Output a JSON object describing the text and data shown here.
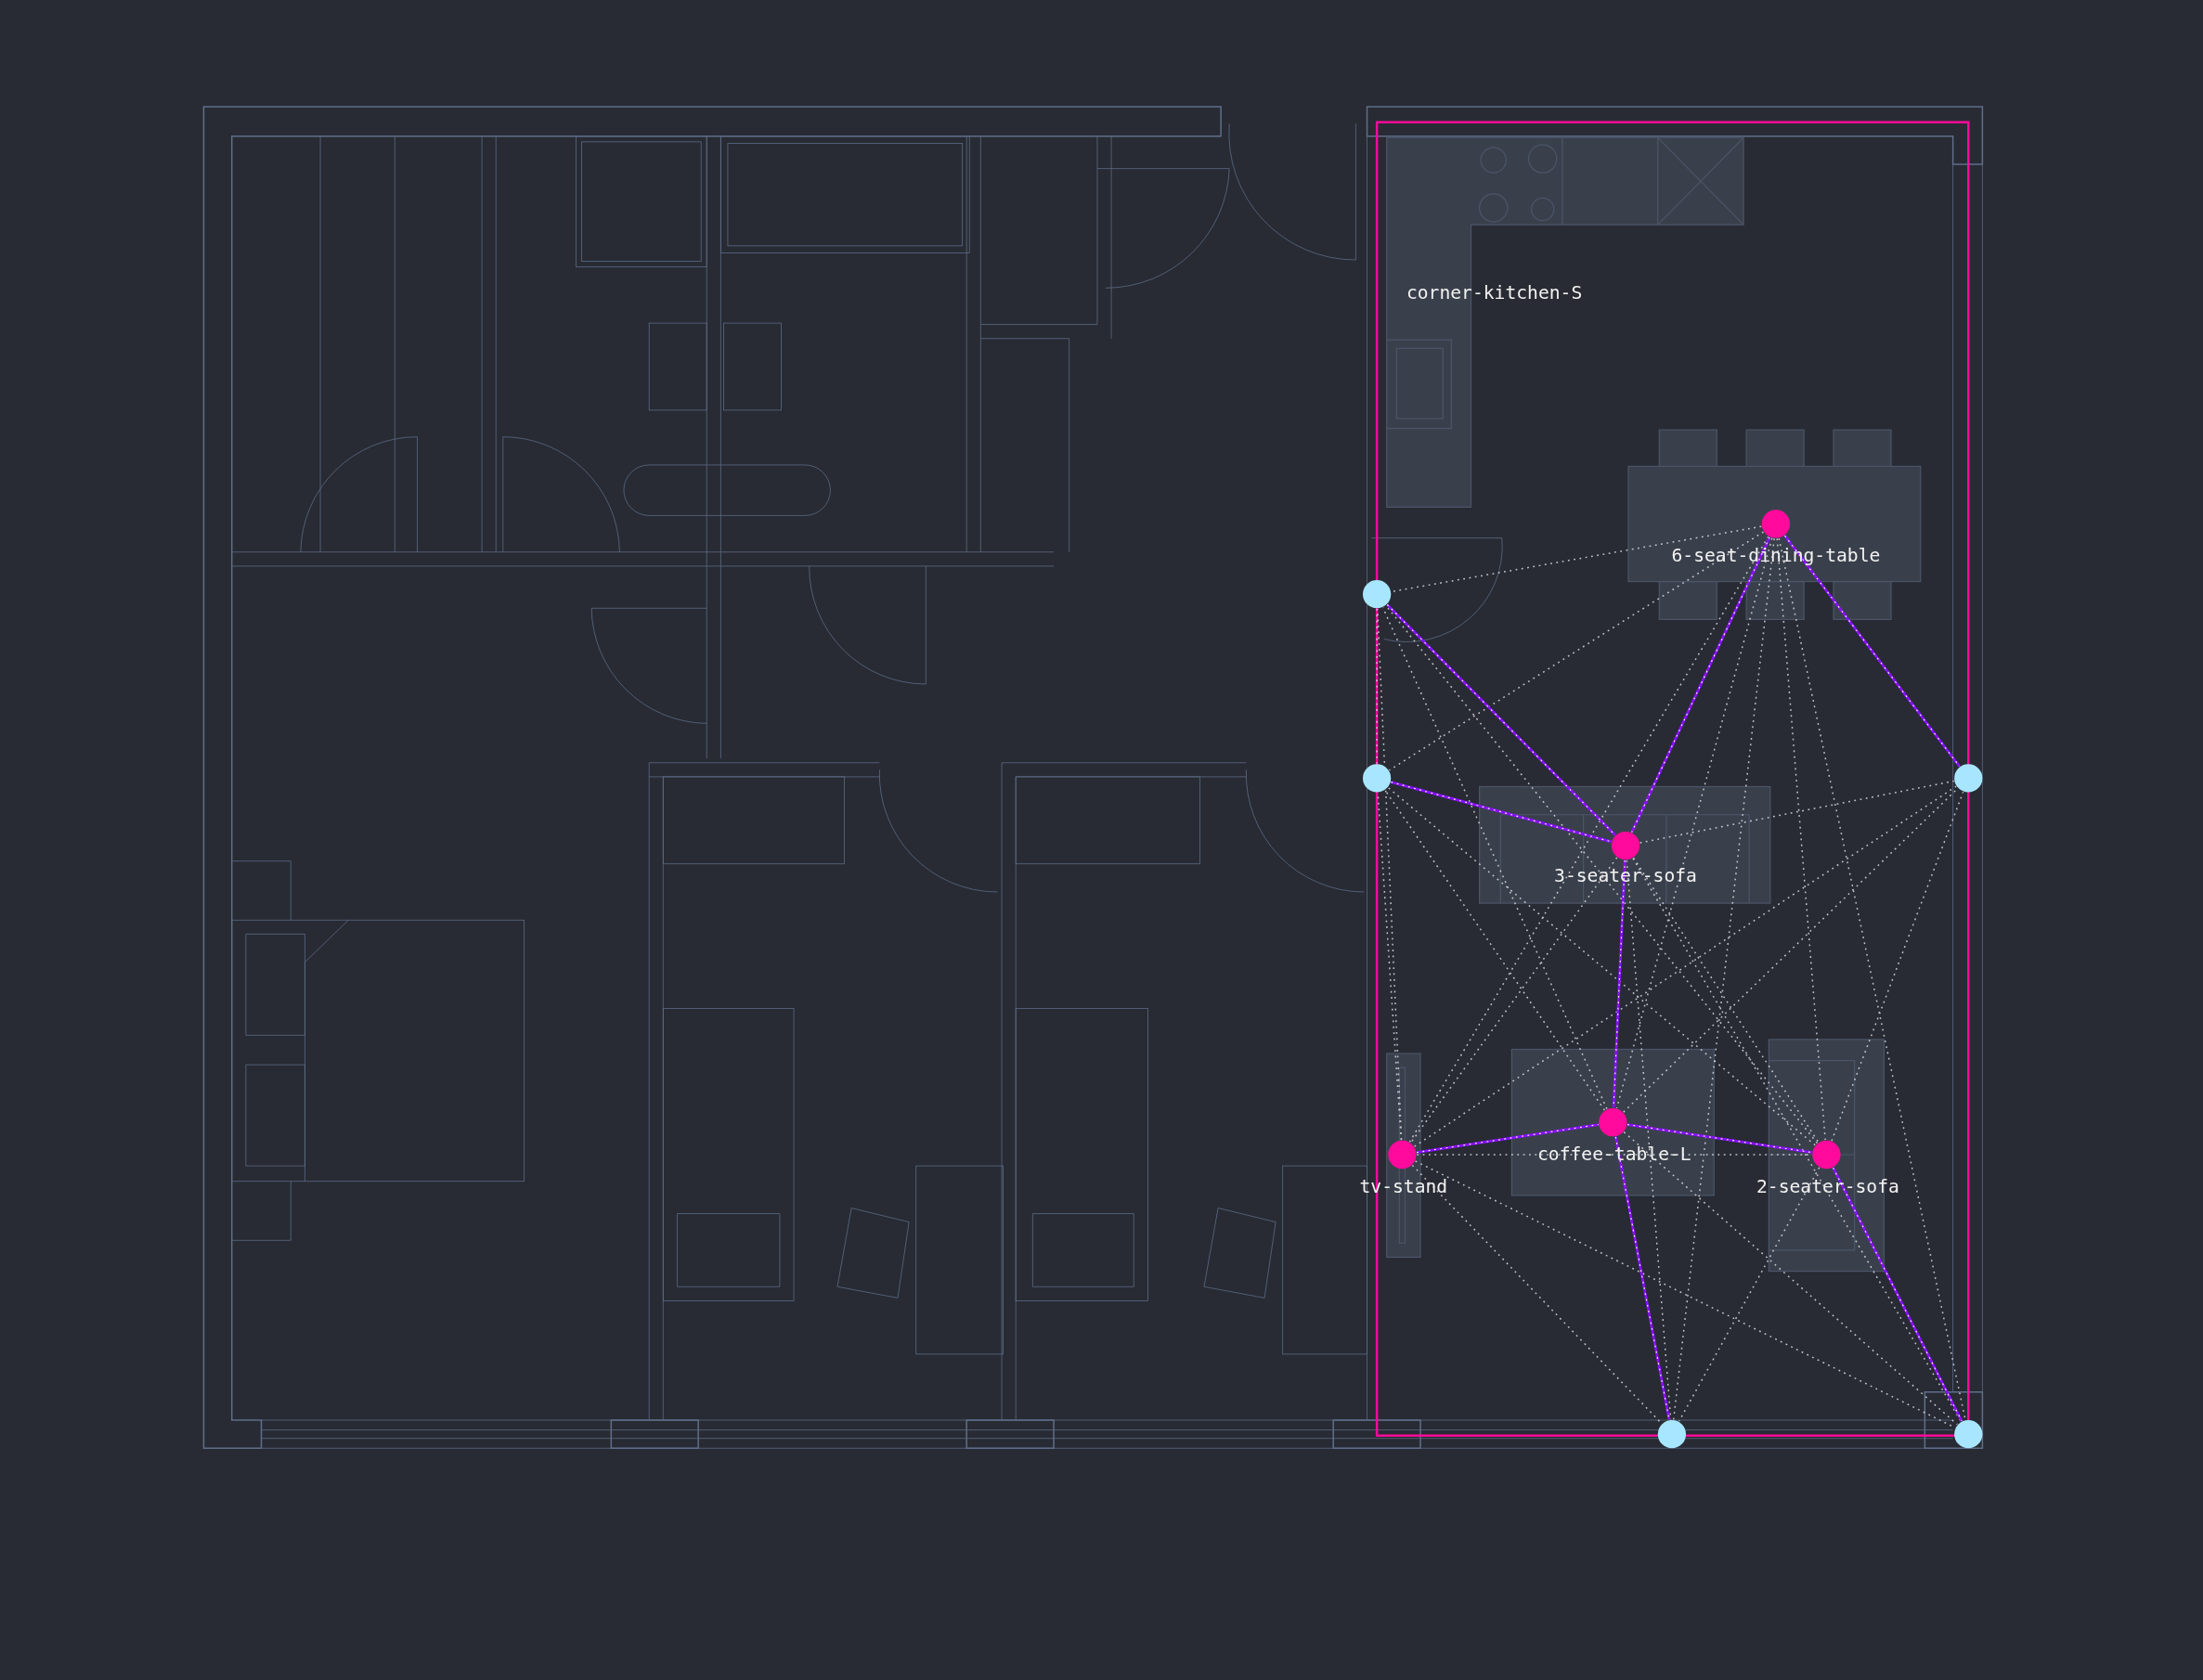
{
  "room_labels": [
    {
      "label": "corner-kitchen-S"
    },
    {
      "label": "6-seat-dining-table"
    },
    {
      "label": "3-seater-sofa"
    },
    {
      "label": "coffee-table-L"
    },
    {
      "label": "tv-stand"
    },
    {
      "label": "2-seater-sofa"
    }
  ]
}
